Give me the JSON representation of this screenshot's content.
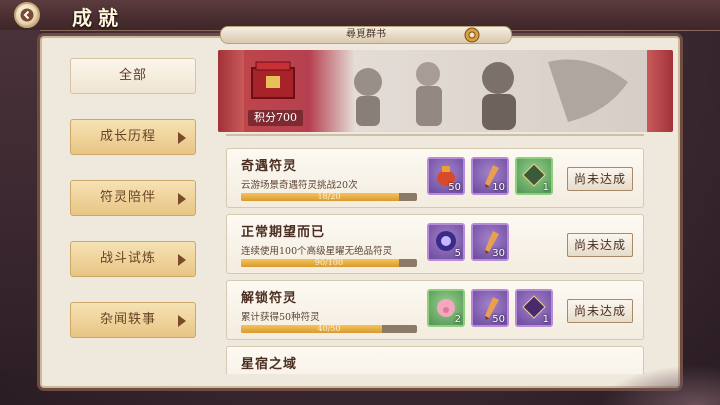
{
  "header": {
    "title": "成就"
  },
  "panel": {
    "roll_label": "尋覓群书"
  },
  "sidebar": {
    "items": [
      {
        "label": "全部"
      },
      {
        "label": "成长历程"
      },
      {
        "label": "符灵陪伴"
      },
      {
        "label": "战斗试炼"
      },
      {
        "label": "杂闻轶事"
      }
    ]
  },
  "banner": {
    "score": "积分700"
  },
  "achievements": [
    {
      "title": "奇遇符灵",
      "desc": "云游场景奇遇符灵挑战20次",
      "progress_text": "18/20",
      "progress": 0.9,
      "rewards": [
        {
          "icon": "red-pouch-icon",
          "qty": "50",
          "color": "purple"
        },
        {
          "icon": "brush-icon",
          "qty": "10",
          "color": "purple"
        },
        {
          "icon": "title-badge-icon",
          "qty": "1",
          "color": "green"
        }
      ],
      "status": "尚未达成"
    },
    {
      "title": "正常期望而已",
      "desc": "连续使用100个高级星曜无绝品符灵",
      "progress_text": "90/100",
      "progress": 0.9,
      "rewards": [
        {
          "icon": "star-orb-icon",
          "qty": "5",
          "color": "purple"
        },
        {
          "icon": "brush-icon",
          "qty": "30",
          "color": "purple"
        }
      ],
      "status": "尚未达成"
    },
    {
      "title": "解锁符灵",
      "desc": "累计获得50种符灵",
      "progress_text": "40/50",
      "progress": 0.8,
      "rewards": [
        {
          "icon": "pink-pig-icon",
          "qty": "2",
          "color": "green"
        },
        {
          "icon": "brush-icon",
          "qty": "50",
          "color": "purple"
        },
        {
          "icon": "title-badge-icon",
          "qty": "1",
          "color": "purple"
        }
      ],
      "status": "尚未达成"
    },
    {
      "title": "星宿之域",
      "desc": "",
      "progress_text": "",
      "progress": 0,
      "rewards": [],
      "status": ""
    }
  ]
}
